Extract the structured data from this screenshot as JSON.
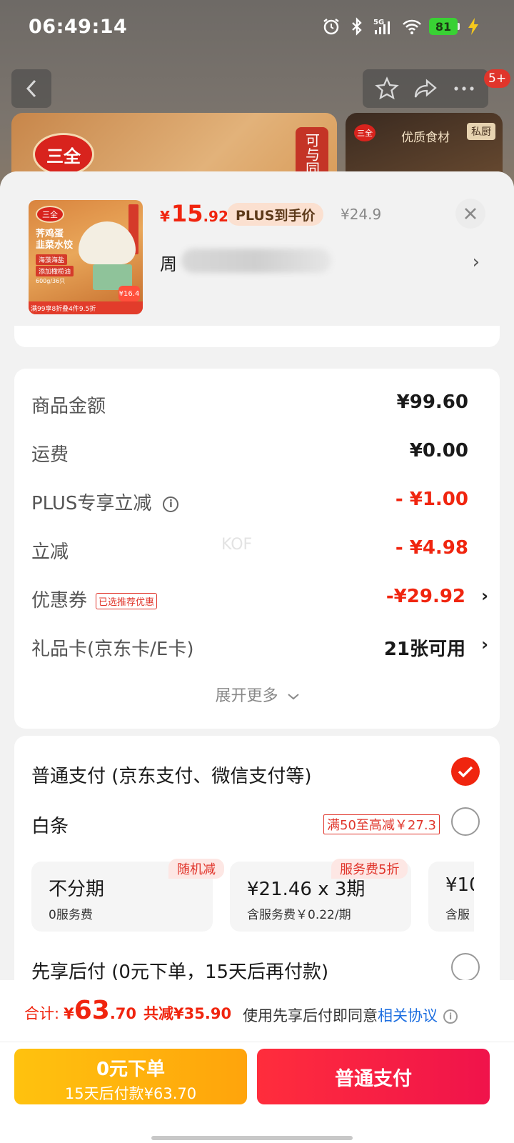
{
  "status_bar": {
    "time": "06:49:14",
    "battery": "81",
    "network": "5G"
  },
  "background_page": {
    "badge": "5+",
    "brand_logo": "三全",
    "side_tag": "可与同",
    "card2_title": "优质食材",
    "card2_tag": "私厨"
  },
  "product": {
    "thumb": {
      "logo": "三全",
      "name_line1": "荠鸡蛋",
      "name_line2": "韭菜水饺",
      "pill1": "海藻海盐",
      "pill2": "添加橄榄油",
      "weight": "600g/36只",
      "price_bubble": "¥16.4",
      "bottom_banner": "满99享8折叠4件9.5折"
    },
    "price_symbol": "¥",
    "price_int": "15",
    "price_dec": ".92",
    "plus_label": "PLUS到手价",
    "original_price": "¥24.9",
    "address_prefix": "周",
    "address_chevron": "›"
  },
  "breakdown": {
    "rows": [
      {
        "label": "商品金额",
        "value": "¥99.60"
      },
      {
        "label": "运费",
        "value": "¥0.00"
      },
      {
        "label": "PLUS专享立减",
        "value": "- ¥1.00"
      },
      {
        "label": "立减",
        "value": "- ¥4.98"
      },
      {
        "label": "优惠券",
        "tag": "已选推荐优惠",
        "value": "-¥29.92"
      },
      {
        "label": "礼品卡(京东卡/E卡)",
        "value": "21张可用"
      }
    ],
    "watermark": "KOF",
    "expand_more": "展开更多"
  },
  "payment": {
    "normal": "普通支付 (京东支付、微信支付等)",
    "baitiao": "白条",
    "baitiao_promo": "满50至高减￥27.3",
    "plans": [
      {
        "main": "不分期",
        "sub": "0服务费",
        "tag": "随机减"
      },
      {
        "main": "¥21.46 x 3期",
        "sub": "含服务费￥0.22/期",
        "tag": "服务费5折"
      },
      {
        "main": "¥10",
        "sub": "含服"
      }
    ],
    "later": "先享后付 (0元下单，15天后再付款)"
  },
  "footer": {
    "total_label": "合计:",
    "total_symbol": "¥",
    "total_int": "63",
    "total_dec": ".70",
    "total_saved": "共减¥35.90",
    "agree_text": "使用先享后付即同意",
    "agree_link": "相关协议",
    "btn_later_line1": "0元下单",
    "btn_later_line2": "15天后付款¥63.70",
    "btn_normal": "普通支付"
  },
  "colors": {
    "accent_red": "#f0250f",
    "pay_yellow": "#ffb10d",
    "pay_red": "#f71e45",
    "link_blue": "#1e6fe0"
  }
}
